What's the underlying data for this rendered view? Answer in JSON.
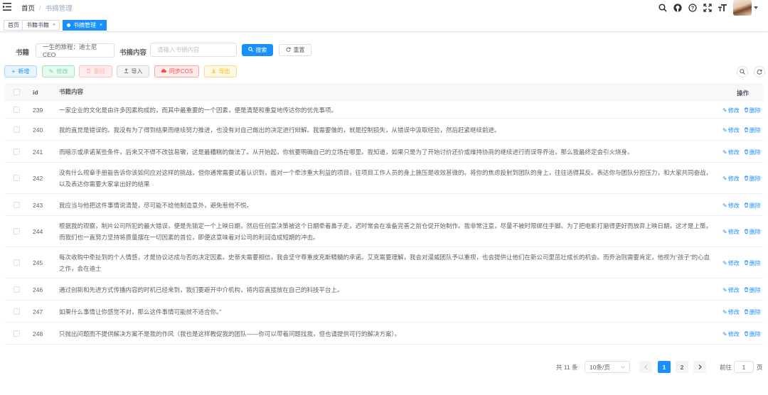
{
  "breadcrumb": {
    "home": "首页",
    "separator": "/",
    "current": "书摘管理"
  },
  "tags": [
    {
      "label": "首页"
    },
    {
      "label": "书籍书籍",
      "close": "×"
    },
    {
      "label": "书摘管理",
      "close": "×"
    }
  ],
  "search": {
    "book_label": "书籍",
    "book_value": "一生的旅程：迪士尼CEO",
    "content_label": "书摘内容",
    "content_placeholder": "请输入书摘内容",
    "search_button": "搜索",
    "reset_button": "重置"
  },
  "toolbar": {
    "add": "新增",
    "edit": "修改",
    "delete": "删除",
    "import": "导入",
    "sync": "同步COS",
    "export": "导出"
  },
  "table": {
    "headers": {
      "id": "id",
      "content": "书籍内容",
      "op": "操作"
    },
    "op_edit": "修改",
    "op_delete": "删除",
    "rows": [
      {
        "id": "239",
        "content": "一家企业的文化是由许多因素构成的，而其中最重要的一个因素，便是清楚和重复地传达你的优先事项。"
      },
      {
        "id": "240",
        "content": "我的直觉是错误的。我没有为了得到结果而继续努力推进，也没有对自己做出的决定进行辩解。我需要做的，就是控制损失，从错误中汲取经验，然后赶紧继续前进。"
      },
      {
        "id": "241",
        "content": "而暗示或承诺某些条件，后来又不得不改弦易辙，这是最糟糕的做法了。从开始起，你就要明确自己的立场在哪里。我知道，如果只是为了开始讨价还价或维持协商的继续进行而误导乔治，那么我最终定会引火烧身。"
      },
      {
        "id": "242",
        "content": "没有什么规章手册能告诉你该如何应对这样的挑战，但你通常需要试着认识到，面对一个牵涉重大利益的项目，往项目工作人员的身上施压是收效甚微的。将你的焦虑投射到团队的身上，往往适得其反。表达你与团队分担压力，和大家共同奋战，以及表达你需要大家拿出好的结果"
      },
      {
        "id": "243",
        "content": "我应当与他把这件事情说清楚，尽可能不给他制造意外，避免惹他不悦。"
      },
      {
        "id": "244",
        "content": "根据我的观察，制片公司所犯的最大错误，便是先锁定一个上映日期，然后任创意决策被这个日期牵着鼻子走，迟时常会在准备完善之前仓促开始制作。我非常注意，尽量不被时限绑住手脚。为了把电影打磨得更好而放弃上映日期，这才是上策，而我们也一直努力坚持将质量摆在一切因素的首位，即便这意味着对公司的利润造成短期的冲击。"
      },
      {
        "id": "245",
        "content": "每次收购中牵扯到的个人情感，才是协议达成与否的决定因素。史蒂夫需要相信，我会坚守尊重皮克斯精髓的承诺。艾克需要理解，我会对漫威团队予以重视，也会提供让他们在新公司里茁壮成长的机会。而乔治则需要肯定，他视为“孩子”的心血之作，会在迪士"
      },
      {
        "id": "246",
        "content": "通过创新和先进方式传播内容的时机已经来到，我们要避开中介机构，将内容直接放在自己的科技平台上。"
      },
      {
        "id": "247",
        "content": "如果什么事情让你感觉不对，那么这件事情可能就不适合你。”"
      },
      {
        "id": "248",
        "content": "只抛出问题而不提供解决方案不是我的作风（我也是这样教促我的团队——你可以带着问题找我，但也请提供可行的解决方案）。"
      }
    ]
  },
  "pagination": {
    "total": "共 11 条",
    "page_size": "10条/页",
    "pages": [
      "1",
      "2"
    ],
    "current_page": "1",
    "jump_prefix": "前往",
    "jump_value": "1",
    "jump_suffix": "页"
  },
  "colors": {
    "primary": "#1890ff",
    "danger": "#ff4949",
    "success": "#13ce66",
    "warning": "#ffba00"
  }
}
